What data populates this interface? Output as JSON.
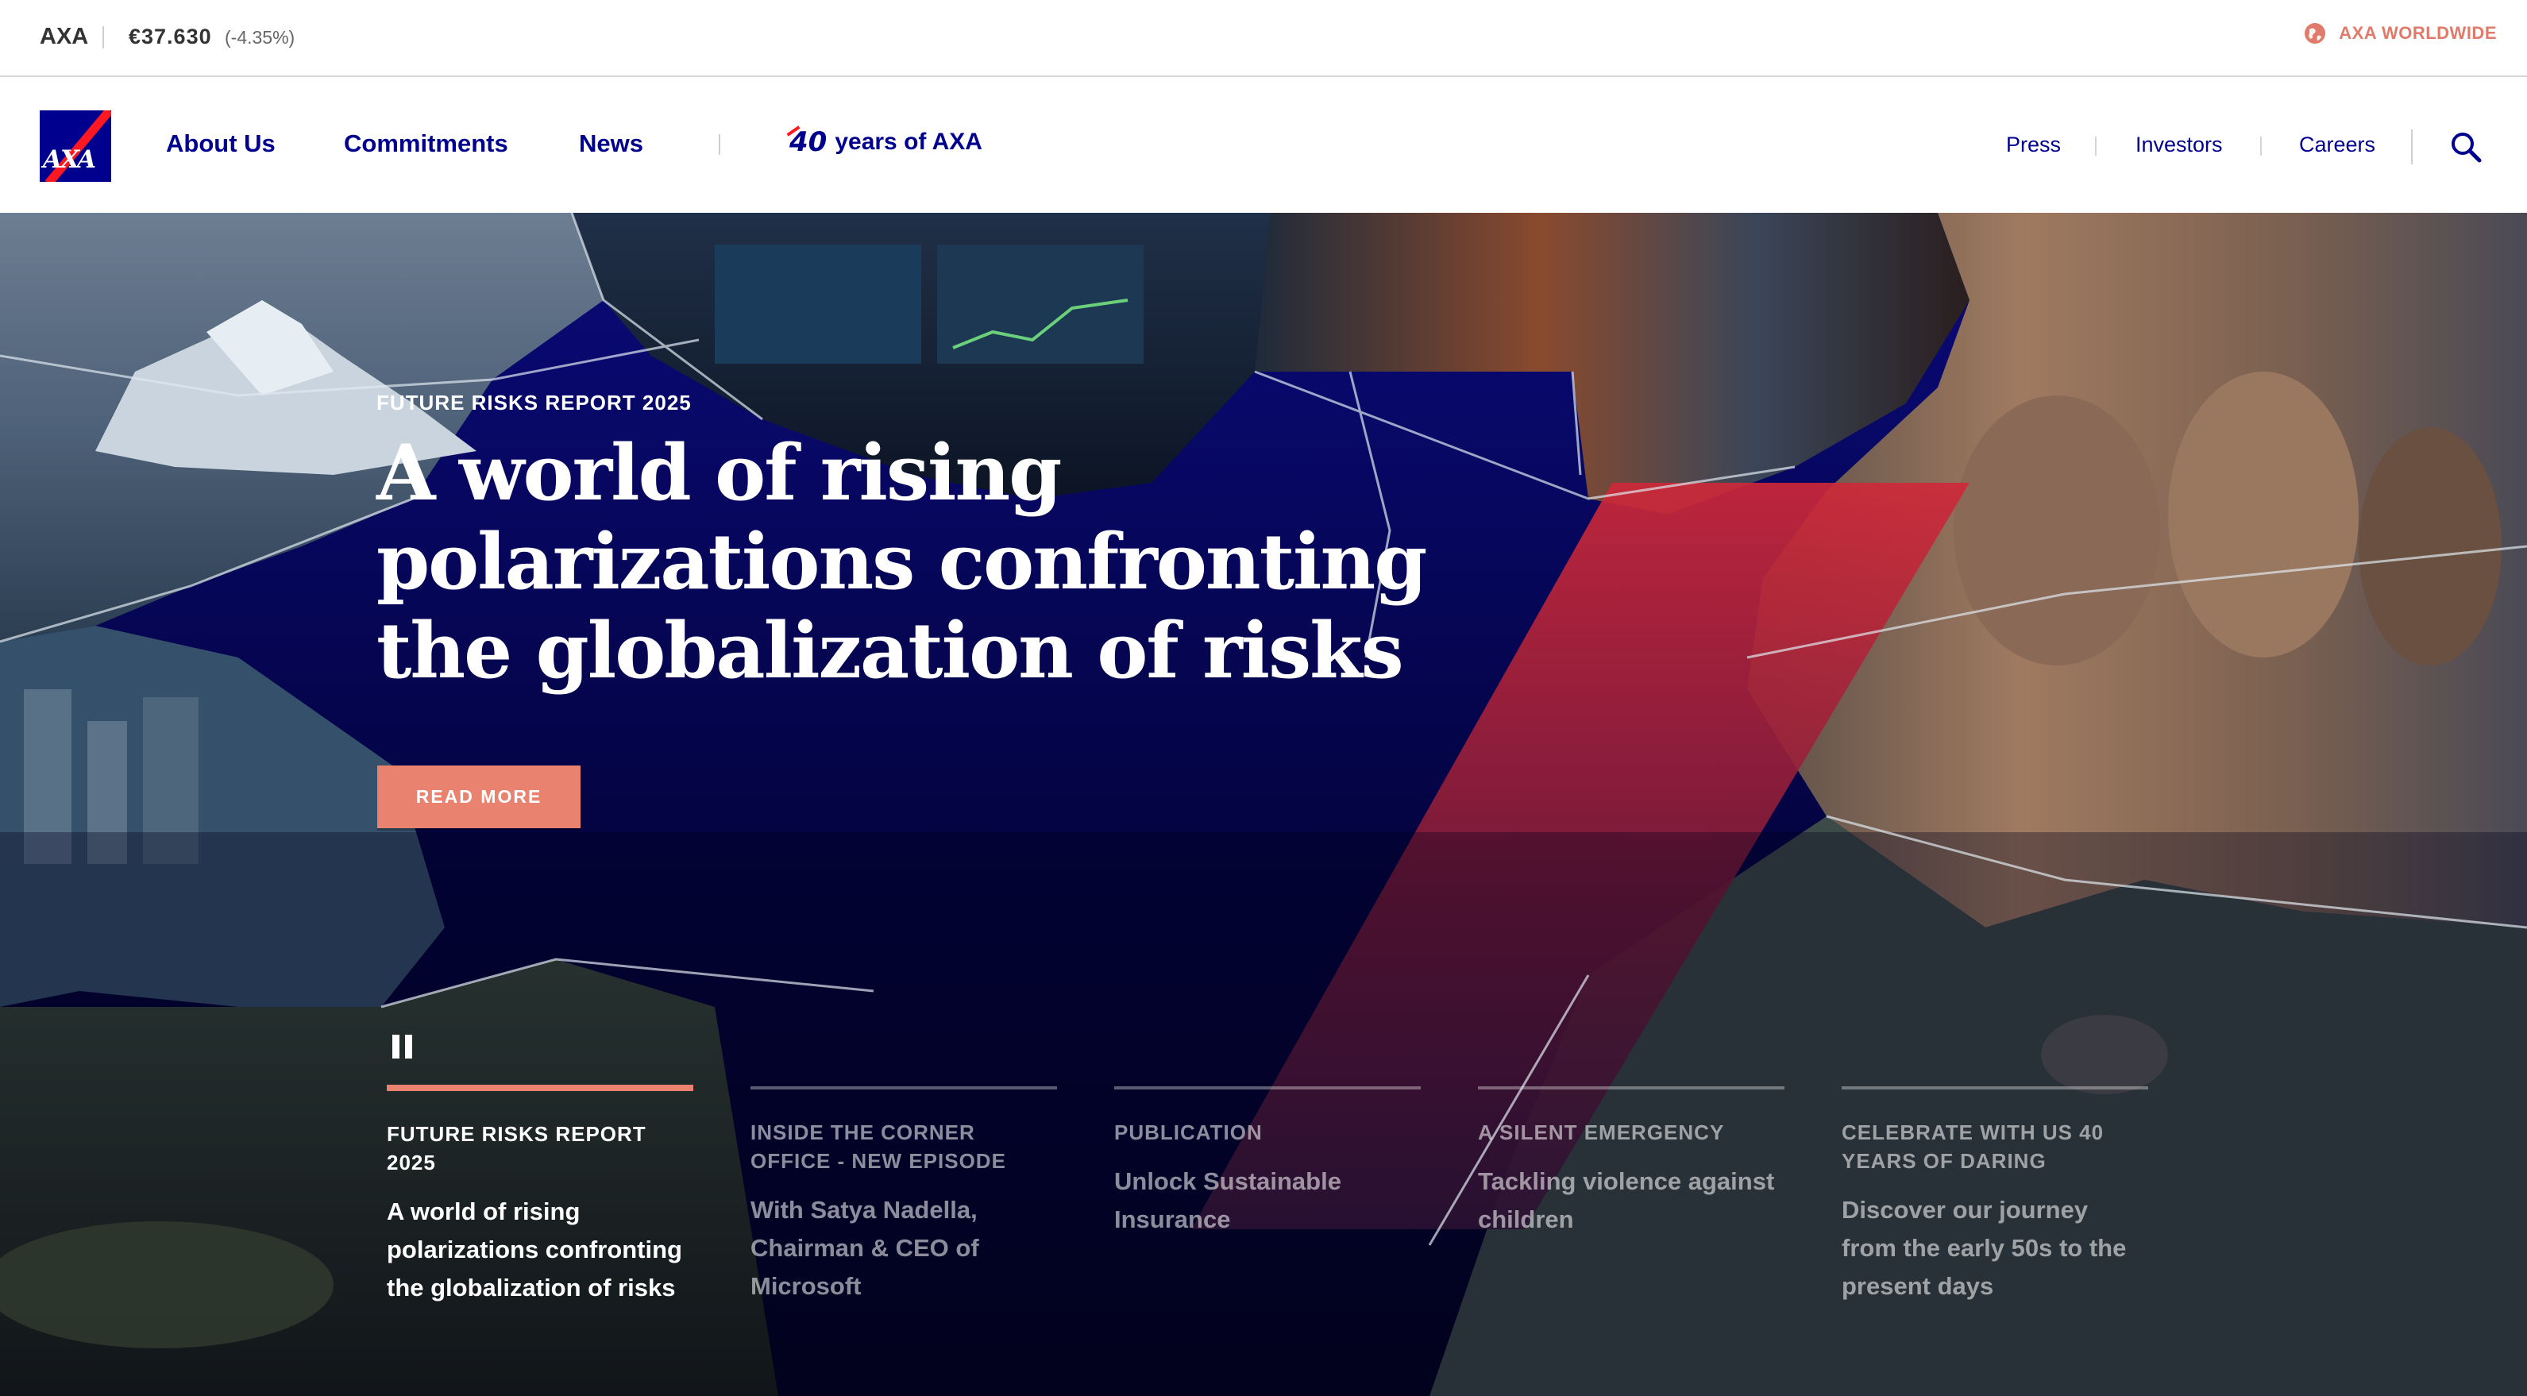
{
  "ticker": {
    "company": "AXA",
    "price": "€37.630",
    "change": "(-4.35%)",
    "worldwide_label": "AXA WORLDWIDE",
    "worldwide_icon": "globe-icon",
    "accent_color": "#e07a6a"
  },
  "brand": {
    "logo_text": "AXA",
    "primary_color": "#00008f",
    "accent_red": "#ff1721"
  },
  "nav": {
    "primary": [
      {
        "label": "About Us"
      },
      {
        "label": "Commitments"
      },
      {
        "label": "News"
      }
    ],
    "anniversary_number": "40",
    "anniversary_label": "years of AXA",
    "secondary": [
      {
        "label": "Press"
      },
      {
        "label": "Investors"
      },
      {
        "label": "Careers"
      }
    ],
    "search_icon": "search-icon"
  },
  "hero": {
    "kicker": "FUTURE RISKS REPORT 2025",
    "headline": "A world of rising polarizations confronting the globalization of risks",
    "cta_label": "READ MORE",
    "cta_color": "#e9836f",
    "pause_icon": "pause-icon",
    "slides": [
      {
        "category": "FUTURE RISKS REPORT 2025",
        "description": "A world of rising polarizations confronting the globalization of risks",
        "active": true
      },
      {
        "category": "INSIDE THE CORNER OFFICE - NEW EPISODE",
        "description": "With Satya Nadella, Chairman & CEO of Microsoft",
        "active": false
      },
      {
        "category": "PUBLICATION",
        "description": "Unlock Sustainable Insurance",
        "active": false
      },
      {
        "category": "A SILENT EMERGENCY",
        "description": "Tackling violence against children",
        "active": false
      },
      {
        "category": "CELEBRATE WITH US 40 YEARS OF DARING",
        "description": "Discover our journey from the early 50s to the present days",
        "active": false
      }
    ]
  }
}
